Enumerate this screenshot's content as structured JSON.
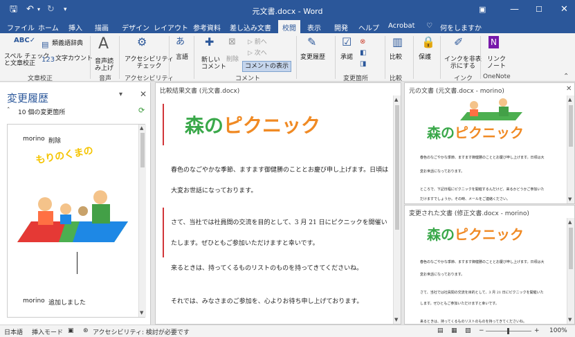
{
  "titlebar": {
    "title": "元文書.docx  -  Word",
    "icons": [
      "save-icon",
      "undo-icon",
      "redo-icon",
      "customize-icon",
      "ribbon-display-icon",
      "minimize-icon",
      "maximize-icon",
      "close-icon"
    ]
  },
  "tabs": [
    "ファイル",
    "ホーム",
    "挿入",
    "描画",
    "デザイン",
    "レイアウト",
    "参考資料",
    "差し込み文書",
    "校閲",
    "表示",
    "開発",
    "ヘルプ",
    "Acrobat",
    "何をしますか"
  ],
  "active_tab": "校閲",
  "ribbon": {
    "spell_check": "スペル チェック\nと文章校正",
    "thesaurus": "類義語辞典",
    "word_count": "文字カウント",
    "group_proofing": "文章校正",
    "read_aloud": "音声読\nみ上げ",
    "group_speech": "音声",
    "accessibility_check": "アクセシビリティ\nチェック",
    "group_accessibility": "アクセシビリティ",
    "language": "言語",
    "new_comment": "新しい\nコメント",
    "delete": "削除",
    "prev": "前へ",
    "next": "次へ",
    "show_comments": "コメントの表示",
    "group_comments": "コメント",
    "track_changes": "変更履歴",
    "accept": "承諾",
    "group_changes": "変更箇所",
    "compare": "比較",
    "group_compare": "比較",
    "protect": "保護",
    "hide_ink": "インクを非表\n示にする",
    "group_ink": "インク",
    "linked_notes": "リンク\nノート",
    "group_onenote": "OneNote"
  },
  "navpane": {
    "title": "変更履歴",
    "count": "10 個の変更箇所",
    "item1_author": "morino",
    "item1_action": "削除",
    "item1_text": "もりのくまの",
    "item2_author": "morino",
    "item2_action": "追加しました"
  },
  "compared": {
    "title": "比較結果文書 (元文書.docx)",
    "heading": "森のピクニック",
    "lines": [
      "春色のなごやかな季節、ますます御健勝のこととお慶び申し上げます。日頃は",
      "大変お世話になっております。",
      "さて、当社では社員間の交流を目的として、3 月 21 日にピクニックを開催い",
      "たします。ぜひともご参加いただけますと幸いです。",
      "来るときは、持ってくるものリストのものを持ってきてくださいね。",
      "それでは、みなさまのご参加を、心よりお待ち申し上げております。"
    ]
  },
  "original": {
    "title": "元の文書 (元文書.docx - morino)",
    "heading": "森のピクニック",
    "lines": [
      "春色のなごやかな季節、ますます御健勝のこととお慶び申し上げます。日頃は大",
      "変お世話になっております。",
      "ところで、下記日程にピクニックを開催するんだけど、来るかどうかご参加いた",
      "だけますでしょうか。その時、メールをご連絡ください。"
    ]
  },
  "revised": {
    "title": "変更された文書 (修正文書.docx - morino)",
    "heading": "森のピクニック",
    "lines": [
      "春色のなごやかな季節、ますます御健勝のこととお慶び申し上げます。日頃は大",
      "変お世話になっております。",
      "さて、当社では社員間の交流を目的として、3 月 21 日にピクニックを開催いた",
      "します。ぜひともご参加いただけますと幸いです。",
      "来るときは、持ってくるものリストのものを持ってきてくださいね。"
    ]
  },
  "status": {
    "language": "日本語",
    "mode": "挿入モード",
    "accessibility": "アクセシビリティ: 検討が必要です",
    "zoom": "100%",
    "zoom_minus": "−",
    "zoom_plus": "+"
  },
  "colors": {
    "accent": "#2b579a",
    "wordart_green": "#3aa84a",
    "wordart_orange": "#f08a24",
    "change_bar": "#d13438"
  }
}
